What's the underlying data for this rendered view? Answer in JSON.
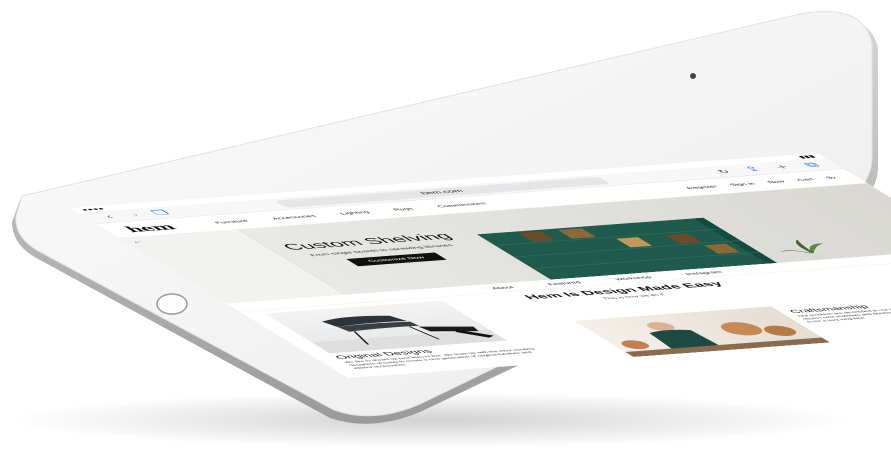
{
  "browser": {
    "address": "hem.com",
    "back_icon": "chevron-left-icon",
    "forward_icon": "chevron-right-icon",
    "bookmarks_icon": "book-icon",
    "share_icon": "share-icon",
    "add_icon": "plus-icon",
    "tabs_icon": "tabs-icon",
    "reload_icon": "reload-icon"
  },
  "site": {
    "logo": "hem",
    "nav": [
      "Furniture",
      "Accessories",
      "Lighting",
      "Rugs",
      "Commissions"
    ],
    "nav_right": [
      "Register",
      "Sign in",
      "Cart",
      "Sv"
    ],
    "nav_extra": "Now"
  },
  "hero": {
    "title": "Custom Shelving",
    "subtitle": "From single boards to sprawling libraries",
    "button": "Customize Now"
  },
  "subnav": [
    "About",
    "Featured",
    "Workshop",
    "Instagram"
  ],
  "intro": {
    "title": "Hem Is Design Made Easy",
    "subtitle": "This is how we do it"
  },
  "sections": {
    "original": {
      "title": "Original Designs",
      "text": "We like to dream up new lines to live. We team up with the most exciting designers of today to create a new generation of original furniture and interior accessories."
    },
    "craft": {
      "title": "Craftsmanship",
      "text": "Our products are developed in our Helsinki workshop. This is where we obsess over materials and finishes to create products you'll want to hold on to for a very long time."
    }
  },
  "colors": {
    "accent": "#1a73e8",
    "cabinet": "#1f5a4c"
  }
}
